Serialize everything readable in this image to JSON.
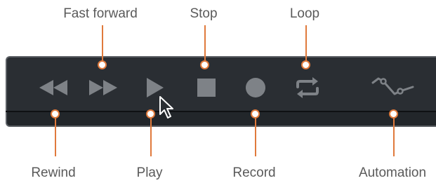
{
  "transport": {
    "callouts": {
      "fast_forward": "Fast forward",
      "stop": "Stop",
      "loop": "Loop",
      "rewind": "Rewind",
      "play": "Play",
      "record": "Record",
      "automation": "Automation"
    },
    "buttons": [
      {
        "name": "rewind",
        "icon": "rewind-icon"
      },
      {
        "name": "fast-forward",
        "icon": "fast-forward-icon"
      },
      {
        "name": "play",
        "icon": "play-icon"
      },
      {
        "name": "stop",
        "icon": "stop-icon"
      },
      {
        "name": "record",
        "icon": "record-icon"
      },
      {
        "name": "loop",
        "icon": "loop-icon"
      },
      {
        "name": "automation",
        "icon": "automation-icon"
      }
    ]
  },
  "colors": {
    "panel": "#2a2e33",
    "icon": "#7e8287",
    "callout": "#e07a3c",
    "label_text": "#5a5a5a"
  }
}
